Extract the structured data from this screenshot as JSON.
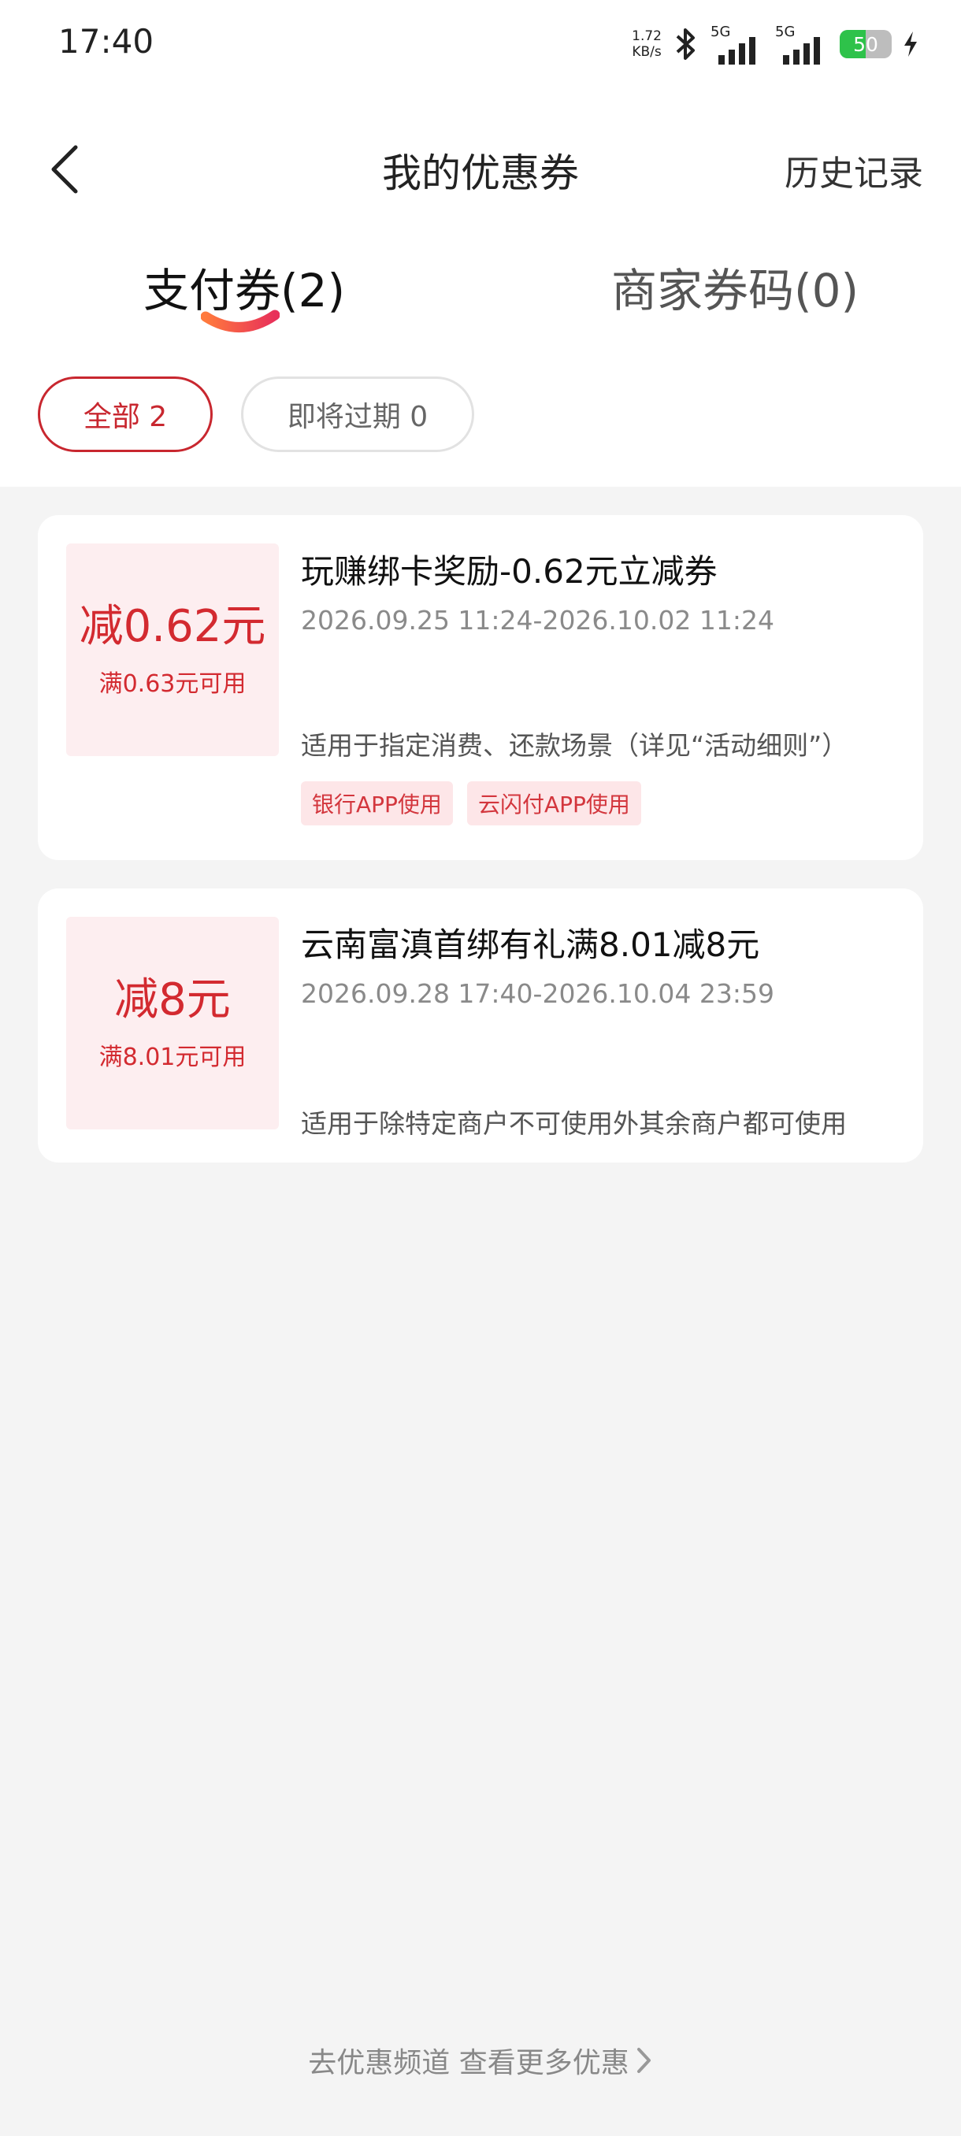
{
  "status_bar": {
    "time": "17:40",
    "net_speed_value": "1.72",
    "net_speed_unit": "KB/s",
    "sim1_label": "5G",
    "sim2_label": "5G",
    "battery_level": "50",
    "battery_color": "#2ec24a"
  },
  "header": {
    "title": "我的优惠券",
    "history": "历史记录"
  },
  "tabs": [
    {
      "label": "支付券(2)",
      "active": true
    },
    {
      "label": "商家券码(0)",
      "active": false
    }
  ],
  "filters": [
    {
      "label": "全部 2",
      "active": true
    },
    {
      "label": "即将过期 0",
      "active": false
    }
  ],
  "coupons": [
    {
      "amount": "减0.62元",
      "condition": "满0.63元可用",
      "title": "玩赚绑卡奖励-0.62元立减券",
      "validity": "2026.09.25 11:24-2026.10.02 11:24",
      "scope": "适用于指定消费、还款场景（详见“活动细则”）",
      "tags": [
        "银行APP使用",
        "云闪付APP使用"
      ]
    },
    {
      "amount": "减8元",
      "condition": "满8.01元可用",
      "title": "云南富滇首绑有礼满8.01减8元",
      "validity": "2026.09.28 17:40-2026.10.04 23:59",
      "scope": "适用于除特定商户不可使用外其余商户都可使用",
      "tags": []
    }
  ],
  "footer": {
    "more_link": "去优惠频道 查看更多优惠"
  },
  "colors": {
    "accent_red": "#c8272f",
    "tag_bg": "#fde6e8",
    "amount_bg": "#fdeef0"
  }
}
